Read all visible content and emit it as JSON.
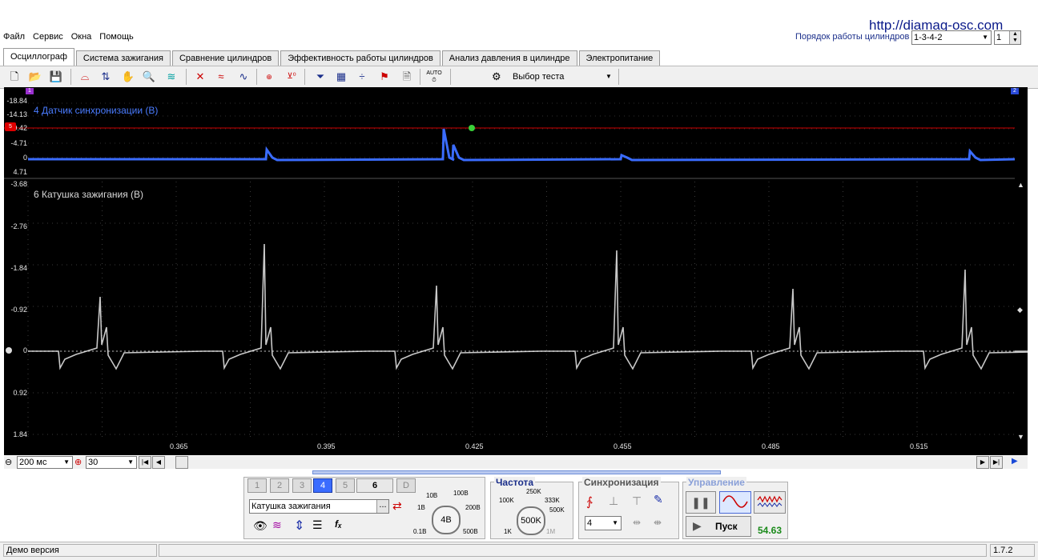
{
  "url_banner": "http://diamag-osc.com",
  "menu": [
    "Файл",
    "Сервис",
    "Окна",
    "Помощь"
  ],
  "cylinder_order": {
    "label": "Порядок работы цилиндров",
    "value": "1-3-4-2",
    "spin_value": "1"
  },
  "tabs": [
    {
      "label": "Осциллограф",
      "active": true
    },
    {
      "label": "Система зажигания"
    },
    {
      "label": "Сравнение цилиндров"
    },
    {
      "label": "Эффективность работы цилиндров"
    },
    {
      "label": "Анализ давления в цилиндре"
    },
    {
      "label": "Электропитание"
    }
  ],
  "toolbar": {
    "test_select_label": "Выбор теста",
    "auto_label": "AUTO"
  },
  "channels": {
    "top": {
      "title": "4 Датчик синхронизации (В)",
      "color": "#3a6cff",
      "ticks": [
        "-18.84",
        "-14.13",
        "-9.42",
        "-4.71",
        "0",
        "4.71"
      ],
      "marker": "5"
    },
    "bottom": {
      "title": "6 Катушка зажигания (В)",
      "color": "#c8c8c8",
      "ticks": [
        "-3.68",
        "-2.76",
        "-1.84",
        "-0.92",
        "0",
        "0.92",
        "1.84"
      ]
    }
  },
  "time_axis": [
    "0.365",
    "0.395",
    "0.425",
    "0.455",
    "0.485",
    "0.515"
  ],
  "corner_markers": {
    "left": "1",
    "right": "2"
  },
  "time_controls": {
    "zoom_value": "200 мс",
    "count_value": "30"
  },
  "channel_panel": {
    "channel_buttons": [
      "1",
      "2",
      "3",
      "4",
      "5",
      "6",
      "D"
    ],
    "selected_channel": "Катушка зажигания",
    "more_btn": "...",
    "voltage_knob": "4В",
    "voltage_ticks": [
      "10В",
      "100В",
      "1В",
      "200В",
      "0.1В",
      "500В"
    ]
  },
  "frequency_panel": {
    "title": "Частота",
    "knob": "500K",
    "ticks": [
      "250K",
      "100K",
      "333K",
      "500K",
      "1K",
      "1M"
    ]
  },
  "sync_panel": {
    "title": "Синхронизация",
    "channel_value": "4"
  },
  "control_panel": {
    "title": "Управление",
    "start_label": "Пуск",
    "fps": "54.63"
  },
  "status": {
    "left": "Демо версия",
    "version": "1.7.2"
  }
}
